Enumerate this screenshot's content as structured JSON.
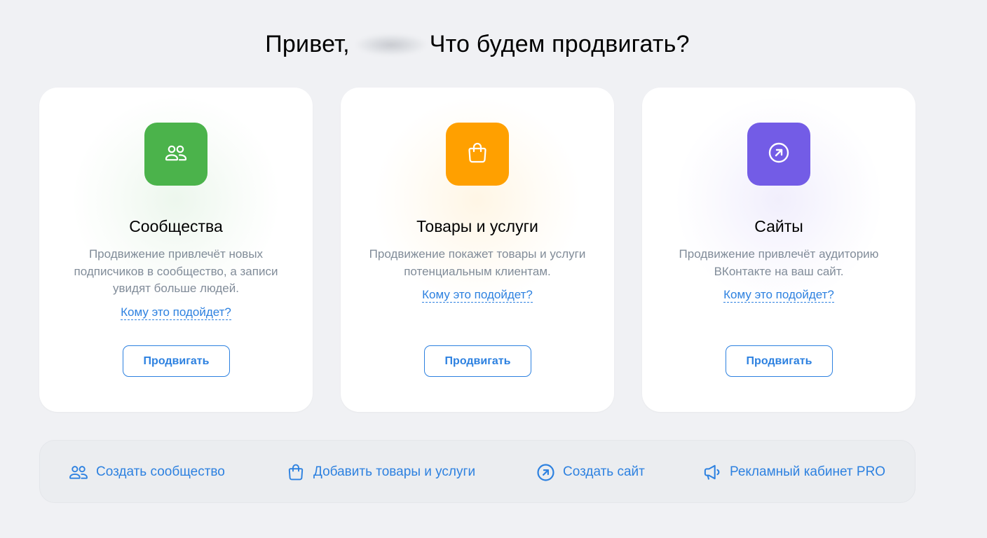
{
  "greeting": {
    "prefix": "Привет,",
    "question": "Что будем продвигать?"
  },
  "cards": [
    {
      "icon": "users-icon",
      "color": "#4bb34b",
      "title": "Сообщества",
      "description": "Продвижение привлечёт новых подписчиков в сообщество, а записи увидят больше людей.",
      "link": "Кому это подойдет?",
      "button": "Продвигать"
    },
    {
      "icon": "shopping-bag-icon",
      "color": "#ffa000",
      "title": "Товары и услуги",
      "description": "Продвижение покажет товары и услуги потенциальным клиентам.",
      "link": "Кому это подойдет?",
      "button": "Продвигать"
    },
    {
      "icon": "arrow-up-right-circle-icon",
      "color": "#735ce6",
      "title": "Сайты",
      "description": "Продвижение привлечёт аудиторию ВКонтакте на ваш сайт.",
      "link": "Кому это подойдет?",
      "button": "Продвигать"
    }
  ],
  "quick_actions": [
    {
      "icon": "users-icon",
      "label": "Создать сообщество"
    },
    {
      "icon": "shopping-bag-icon",
      "label": "Добавить товары и услуги"
    },
    {
      "icon": "arrow-up-right-circle-icon",
      "label": "Создать сайт"
    },
    {
      "icon": "megaphone-icon",
      "label": "Рекламный кабинет PRO"
    }
  ],
  "colors": {
    "accent": "#2d81e0",
    "secondary_text": "#818c99",
    "background": "#f0f1f4"
  }
}
